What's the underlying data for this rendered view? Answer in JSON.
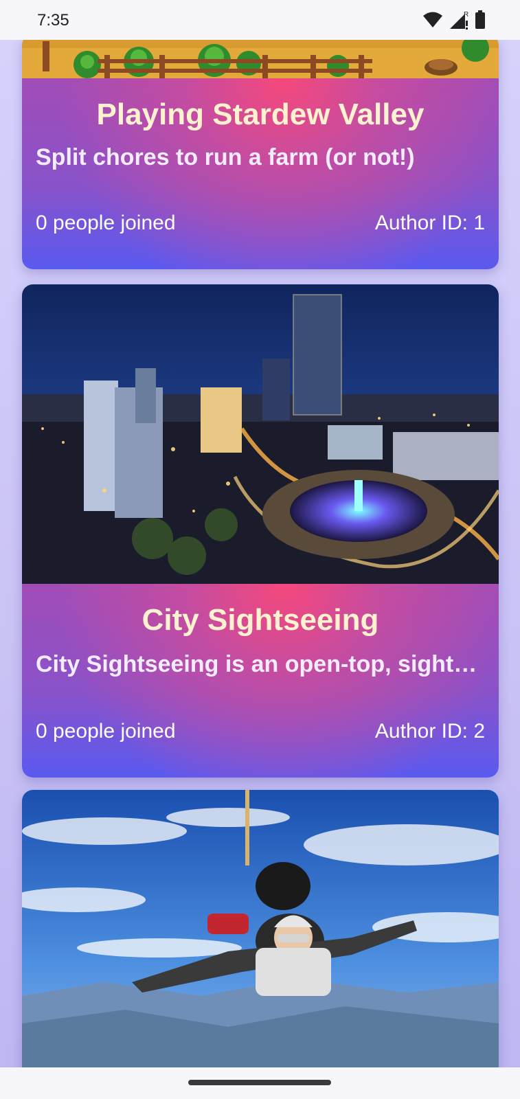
{
  "status_bar": {
    "time": "7:35",
    "icons": [
      "wifi-icon",
      "signal-roaming-icon",
      "battery-icon"
    ]
  },
  "cards": [
    {
      "image": "stardew-valley-farm",
      "title": "Playing Stardew Valley",
      "description": "Split chores to run a farm (or not!)",
      "joined": "0 people joined",
      "author": "Author ID: 1"
    },
    {
      "image": "city-night-fountain",
      "title": "City Sightseeing",
      "description": "City Sightseeing is an open-top, sights…",
      "joined": "0 people joined",
      "author": "Author ID: 2"
    },
    {
      "image": "tandem-skydiving"
    }
  ],
  "colors": {
    "card_gradient_top": "#f04878",
    "card_gradient_bottom": "#5a5af0",
    "title_color": "#fff2cf",
    "background": "#d7d3fb"
  }
}
